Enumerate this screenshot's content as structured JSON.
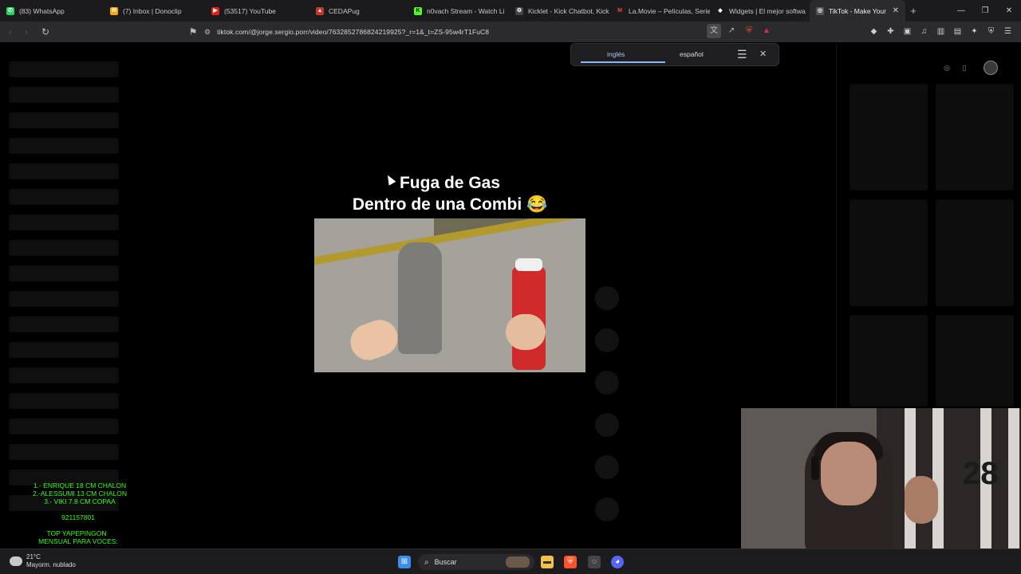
{
  "tabs": [
    {
      "label": "(83) WhatsApp",
      "color": "#25d366",
      "glyph": "✆"
    },
    {
      "label": "(7) Inbox | Donoclip",
      "color": "#f2a900",
      "glyph": "✉"
    },
    {
      "label": "(53517) YouTube",
      "color": "#e62117",
      "glyph": "▶"
    },
    {
      "label": "CEDAPug",
      "color": "#c0392b",
      "glyph": "▲"
    },
    {
      "label": "n0vach Stream - Watch Li",
      "color": "#53fc18",
      "glyph": "K"
    },
    {
      "label": "Kicklet - Kick Chatbot, Kick",
      "color": "#444",
      "glyph": "⚙"
    },
    {
      "label": "La.Movie – Películas, Serie",
      "color": "#c0392b",
      "glyph": "M"
    },
    {
      "label": "Widgets | El mejor softwa",
      "color": "#fff",
      "glyph": "◆"
    },
    {
      "label": "TikTok - Make Your Da",
      "color": "#555",
      "glyph": "◎"
    }
  ],
  "browser": {
    "url": "tiktok.com/@jorge.sergio.porr/video/7632852786824219925?_r=1&_t=ZS-95w4rT1FuC8"
  },
  "translate": {
    "from": "inglés",
    "to": "español"
  },
  "video": {
    "caption_line1": "Fuga de Gas",
    "caption_line2": "Dentro de una Combi 😂"
  },
  "overlay": {
    "line1": "1.- ENRIQUE 18 CM CHALON",
    "line2": "2.-ALESSUMI 13 CM CHALON",
    "line3": "3.- VIKI 7.8 CM COPAA",
    "code": "921157801",
    "promo1": "TOP YAPEPINGON",
    "promo2": "MENSUAL PARA VOCES:"
  },
  "webcam": {
    "jersey_number": "28"
  },
  "taskbar": {
    "temperature": "21°C",
    "condition": "Mayorm. nublado",
    "search_label": "Buscar"
  }
}
